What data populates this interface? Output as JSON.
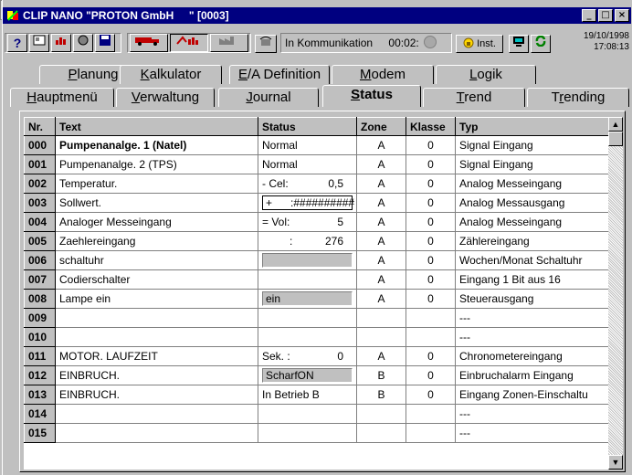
{
  "window": {
    "title": "CLIP NANO \"PROTON GmbH     \" [0003]"
  },
  "toolbar": {
    "status_text": "In Kommunikation",
    "timer": "00:02:",
    "inst_label": "Inst.",
    "date": "19/10/1998",
    "time": "17:08:13",
    "icons": [
      "help-icon",
      "card-icon",
      "chart-icon",
      "disk-icon",
      "save-icon",
      "truck-icon",
      "bar-chart-icon",
      "factory-icon",
      "phone-icon",
      "lock-icon",
      "monitor-icon",
      "refresh-icon"
    ]
  },
  "tabs_top": [
    {
      "label": "Planung",
      "u": "P"
    },
    {
      "label": "Kalkulator",
      "u": "K"
    },
    {
      "label": "E/A Definition",
      "u": "E"
    },
    {
      "label": "Modem",
      "u": "M"
    },
    {
      "label": "Logik",
      "u": "L"
    }
  ],
  "tabs_bottom": [
    {
      "label": "Hauptmenü",
      "u": "H"
    },
    {
      "label": "Verwaltung",
      "u": "V"
    },
    {
      "label": "Journal",
      "u": "J"
    },
    {
      "label": "Status",
      "u": "S",
      "active": true
    },
    {
      "label": "Trend",
      "u": "T"
    },
    {
      "label": "Trending",
      "u": "r"
    }
  ],
  "table": {
    "headers": [
      "Nr.",
      "Text",
      "Status",
      "Zone",
      "Klasse",
      "Typ"
    ],
    "rows": [
      {
        "nr": "000",
        "text": "Pumpenanalge. 1 (Natel)",
        "bold": true,
        "status": {
          "kind": "text",
          "value": "Normal"
        },
        "zone": "A",
        "klasse": "0",
        "typ": "Signal Eingang"
      },
      {
        "nr": "001",
        "text": "Pumpenanalge. 2 (TPS)",
        "status": {
          "kind": "text",
          "value": "Normal"
        },
        "zone": "A",
        "klasse": "0",
        "typ": "Signal Eingang"
      },
      {
        "nr": "002",
        "text": "Temperatur.",
        "status": {
          "kind": "val",
          "label": "- Cel:",
          "value": "0,5"
        },
        "zone": "A",
        "klasse": "0",
        "typ": "Analog Messeingang"
      },
      {
        "nr": "003",
        "text": "Sollwert.",
        "status": {
          "kind": "whitebox",
          "value": "+      :##########"
        },
        "zone": "A",
        "klasse": "0",
        "typ": "Analog Messausgang"
      },
      {
        "nr": "004",
        "text": "Analoger Messeingang",
        "status": {
          "kind": "val",
          "label": "= Vol:",
          "value": "5"
        },
        "zone": "A",
        "klasse": "0",
        "typ": "Analog Messeingang"
      },
      {
        "nr": "005",
        "text": "Zaehlereingang",
        "status": {
          "kind": "val",
          "label": "         :",
          "value": "276"
        },
        "zone": "A",
        "klasse": "0",
        "typ": "Zählereingang"
      },
      {
        "nr": "006",
        "text": "schaltuhr",
        "status": {
          "kind": "box",
          "value": ""
        },
        "zone": "A",
        "klasse": "0",
        "typ": "Wochen/Monat Schaltuhr"
      },
      {
        "nr": "007",
        "text": "Codierschalter",
        "status": {
          "kind": "text",
          "value": ""
        },
        "zone": "A",
        "klasse": "0",
        "typ": "Eingang 1 Bit aus 16"
      },
      {
        "nr": "008",
        "text": "Lampe ein",
        "status": {
          "kind": "box",
          "value": "ein"
        },
        "zone": "A",
        "klasse": "0",
        "typ": "Steuerausgang"
      },
      {
        "nr": "009",
        "text": "",
        "status": {
          "kind": "text",
          "value": ""
        },
        "zone": "",
        "klasse": "",
        "typ": "---"
      },
      {
        "nr": "010",
        "text": "",
        "status": {
          "kind": "text",
          "value": ""
        },
        "zone": "",
        "klasse": "",
        "typ": "---"
      },
      {
        "nr": "011",
        "text": "MOTOR. LAUFZEIT",
        "status": {
          "kind": "val",
          "label": "Sek. :",
          "value": "0"
        },
        "zone": "A",
        "klasse": "0",
        "typ": "Chronometereingang"
      },
      {
        "nr": "012",
        "text": "EINBRUCH.",
        "status": {
          "kind": "box",
          "value": "ScharfON"
        },
        "zone": "B",
        "klasse": "0",
        "typ": "Einbruchalarm Eingang"
      },
      {
        "nr": "013",
        "text": "EINBRUCH.",
        "status": {
          "kind": "text",
          "value": "In Betrieb B"
        },
        "zone": "B",
        "klasse": "0",
        "typ": "Eingang Zonen-Einschaltu"
      },
      {
        "nr": "014",
        "text": "",
        "status": {
          "kind": "text",
          "value": ""
        },
        "zone": "",
        "klasse": "",
        "typ": "---"
      },
      {
        "nr": "015",
        "text": "",
        "status": {
          "kind": "text",
          "value": ""
        },
        "zone": "",
        "klasse": "",
        "typ": "---"
      }
    ]
  }
}
